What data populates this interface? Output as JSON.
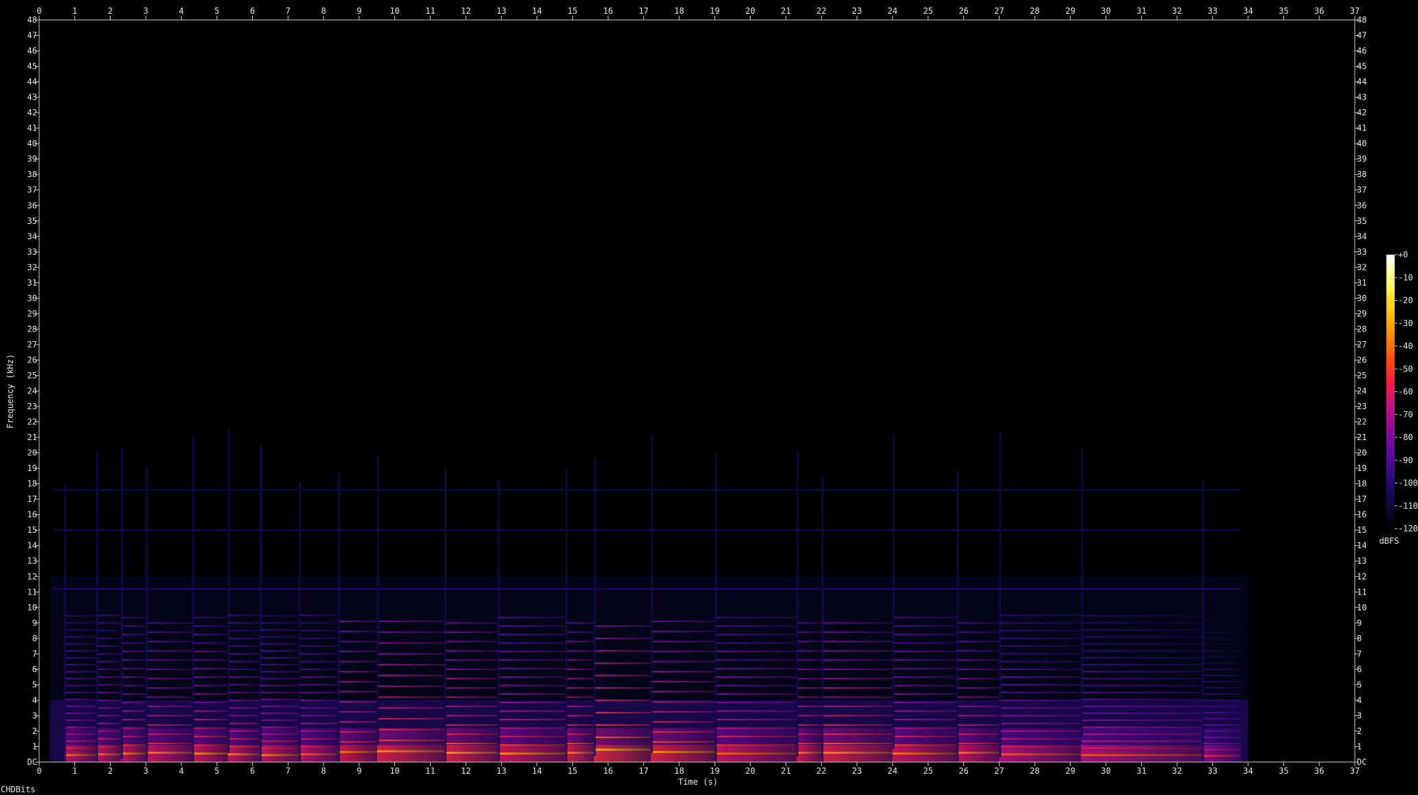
{
  "footer": {
    "label": "CHDBits"
  },
  "chart_data": {
    "type": "heatmap",
    "title": "",
    "xlabel": "Time (s)",
    "ylabel": "Frequency (kHz)",
    "xlim": [
      0,
      37
    ],
    "ylim": [
      0,
      48
    ],
    "x_ticks": [
      "0",
      "1",
      "2",
      "3",
      "4",
      "5",
      "6",
      "7",
      "8",
      "9",
      "10",
      "11",
      "12",
      "13",
      "14",
      "15",
      "16",
      "17",
      "18",
      "19",
      "20",
      "21",
      "22",
      "23",
      "24",
      "25",
      "26",
      "27",
      "28",
      "29",
      "30",
      "31",
      "32",
      "33",
      "34",
      "35",
      "36",
      "37"
    ],
    "y_ticks": [
      "DC",
      "1",
      "2",
      "3",
      "4",
      "5",
      "6",
      "7",
      "8",
      "9",
      "10",
      "11",
      "12",
      "13",
      "14",
      "15",
      "16",
      "17",
      "18",
      "19",
      "20",
      "21",
      "22",
      "23",
      "24",
      "25",
      "26",
      "27",
      "28",
      "29",
      "30",
      "31",
      "32",
      "33",
      "34",
      "35",
      "36",
      "37",
      "38",
      "39",
      "40",
      "41",
      "42",
      "43",
      "44",
      "45",
      "46",
      "47",
      "48"
    ],
    "colorbar": {
      "label": "dBFS",
      "range": [
        -120,
        0
      ],
      "ticks": [
        "+0",
        "-10",
        "-20",
        "-30",
        "-40",
        "-50",
        "-60",
        "-70",
        "-80",
        "-90",
        "-100",
        "-110",
        "-120"
      ],
      "colors": [
        "#000000",
        "#0a0a3c",
        "#2a0a78",
        "#5a0aa0",
        "#8c0a9a",
        "#c8147a",
        "#ff1e3c",
        "#ff5a0a",
        "#ff9a0a",
        "#ffd21e",
        "#ffff78",
        "#ffffff"
      ]
    },
    "signal_end_s": 34,
    "notes": [
      {
        "start_s": 0.7,
        "end_s": 1.6,
        "f0_khz": 0.45,
        "level_db": -38
      },
      {
        "start_s": 1.6,
        "end_s": 2.3,
        "f0_khz": 0.5,
        "level_db": -36
      },
      {
        "start_s": 2.3,
        "end_s": 3.0,
        "f0_khz": 0.55,
        "level_db": -35
      },
      {
        "start_s": 3.0,
        "end_s": 4.3,
        "f0_khz": 0.6,
        "level_db": -35
      },
      {
        "start_s": 4.3,
        "end_s": 5.3,
        "f0_khz": 0.55,
        "level_db": -34
      },
      {
        "start_s": 5.3,
        "end_s": 6.2,
        "f0_khz": 0.5,
        "level_db": -36
      },
      {
        "start_s": 6.2,
        "end_s": 7.3,
        "f0_khz": 0.45,
        "level_db": -36
      },
      {
        "start_s": 7.3,
        "end_s": 8.4,
        "f0_khz": 0.5,
        "level_db": -38
      },
      {
        "start_s": 8.4,
        "end_s": 9.5,
        "f0_khz": 0.65,
        "level_db": -32
      },
      {
        "start_s": 9.5,
        "end_s": 11.4,
        "f0_khz": 0.7,
        "level_db": -30
      },
      {
        "start_s": 11.4,
        "end_s": 12.9,
        "f0_khz": 0.6,
        "level_db": -30
      },
      {
        "start_s": 12.9,
        "end_s": 14.8,
        "f0_khz": 0.55,
        "level_db": -34
      },
      {
        "start_s": 14.8,
        "end_s": 15.6,
        "f0_khz": 0.6,
        "level_db": -30
      },
      {
        "start_s": 15.6,
        "end_s": 17.2,
        "f0_khz": 0.8,
        "level_db": -28
      },
      {
        "start_s": 17.2,
        "end_s": 19.0,
        "f0_khz": 0.65,
        "level_db": -30
      },
      {
        "start_s": 19.0,
        "end_s": 21.3,
        "f0_khz": 0.55,
        "level_db": -36
      },
      {
        "start_s": 21.3,
        "end_s": 22.0,
        "f0_khz": 0.6,
        "level_db": -32
      },
      {
        "start_s": 22.0,
        "end_s": 24.0,
        "f0_khz": 0.6,
        "level_db": -30
      },
      {
        "start_s": 24.0,
        "end_s": 25.8,
        "f0_khz": 0.55,
        "level_db": -35
      },
      {
        "start_s": 25.8,
        "end_s": 27.0,
        "f0_khz": 0.6,
        "level_db": -35
      },
      {
        "start_s": 27.0,
        "end_s": 29.3,
        "f0_khz": 0.5,
        "level_db": -40
      },
      {
        "start_s": 29.3,
        "end_s": 32.7,
        "f0_khz": 0.45,
        "level_db": -42
      },
      {
        "start_s": 32.7,
        "end_s": 33.8,
        "f0_khz": 0.4,
        "level_db": -50
      }
    ],
    "tones": [
      {
        "f_khz": 11.2,
        "start_s": 0.4,
        "end_s": 33.8,
        "level_db": -105
      },
      {
        "f_khz": 15.0,
        "start_s": 0.4,
        "end_s": 33.8,
        "level_db": -108
      },
      {
        "f_khz": 17.6,
        "start_s": 0.4,
        "end_s": 33.8,
        "level_db": -110
      }
    ]
  }
}
